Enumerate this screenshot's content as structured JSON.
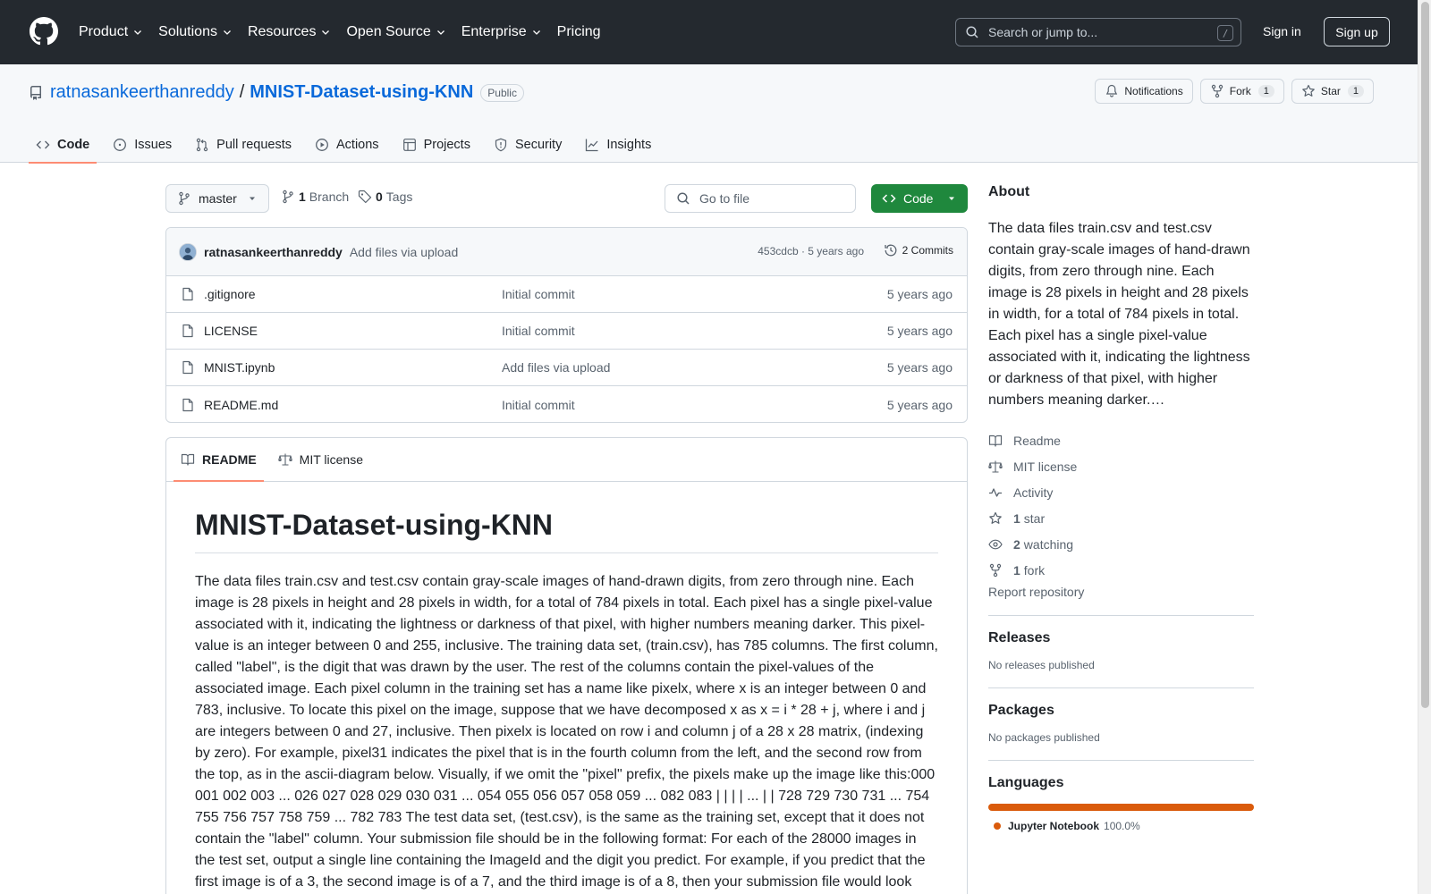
{
  "header": {
    "nav": [
      "Product",
      "Solutions",
      "Resources",
      "Open Source",
      "Enterprise",
      "Pricing"
    ],
    "search_placeholder": "Search or jump to...",
    "search_shortcut": "/",
    "sign_in": "Sign in",
    "sign_up": "Sign up"
  },
  "repo": {
    "owner": "ratnasankeerthanreddy",
    "separator": "/",
    "name": "MNIST-Dataset-using-KNN",
    "visibility": "Public",
    "notifications": "Notifications",
    "fork_label": "Fork",
    "fork_count": "1",
    "star_label": "Star",
    "star_count": "1",
    "tabs": [
      "Code",
      "Issues",
      "Pull requests",
      "Actions",
      "Projects",
      "Security",
      "Insights"
    ]
  },
  "toolbar": {
    "branch": "master",
    "branch_count": "1",
    "branch_label": "Branch",
    "tag_count": "0",
    "tag_label": "Tags",
    "goto_placeholder": "Go to file",
    "code_button": "Code"
  },
  "latest_commit": {
    "author": "ratnasankeerthanreddy",
    "message": "Add files via upload",
    "meta": "453cdcb · 5 years ago",
    "commits": "2 Commits"
  },
  "files": [
    {
      "name": ".gitignore",
      "commit": "Initial commit",
      "date": "5 years ago"
    },
    {
      "name": "LICENSE",
      "commit": "Initial commit",
      "date": "5 years ago"
    },
    {
      "name": "MNIST.ipynb",
      "commit": "Add files via upload",
      "date": "5 years ago"
    },
    {
      "name": "README.md",
      "commit": "Initial commit",
      "date": "5 years ago"
    }
  ],
  "readme": {
    "tab_readme": "README",
    "tab_license": "MIT license",
    "title": "MNIST-Dataset-using-KNN",
    "body": "The data files train.csv and test.csv contain gray-scale images of hand-drawn digits, from zero through nine. Each image is 28 pixels in height and 28 pixels in width, for a total of 784 pixels in total. Each pixel has a single pixel-value associated with it, indicating the lightness or darkness of that pixel, with higher numbers meaning darker. This pixel-value is an integer between 0 and 255, inclusive. The training data set, (train.csv), has 785 columns. The first column, called \"label\", is the digit that was drawn by the user. The rest of the columns contain the pixel-values of the associated image. Each pixel column in the training set has a name like pixelx, where x is an integer between 0 and 783, inclusive. To locate this pixel on the image, suppose that we have decomposed x as x = i * 28 + j, where i and j are integers between 0 and 27, inclusive. Then pixelx is located on row i and column j of a 28 x 28 matrix, (indexing by zero). For example, pixel31 indicates the pixel that is in the fourth column from the left, and the second row from the top, as in the ascii-diagram below. Visually, if we omit the \"pixel\" prefix, the pixels make up the image like this:000 001 002 003 ... 026 027 028 029 030 031 ... 054 055 056 057 058 059 ... 082 083 | | | | ... | | 728 729 730 731 ... 754 755 756 757 758 759 ... 782 783 The test data set, (test.csv), is the same as the training set, except that it does not contain the \"label\" column. Your submission file should be in the following format: For each of the 28000 images in the test set, output a single line containing the ImageId and the digit you predict. For example, if you predict that the first image is of a 3, the second image is of a 7, and the third image is of a 8, then your submission file would look"
  },
  "sidebar": {
    "about_title": "About",
    "description": "The data files train.csv and test.csv contain gray-scale images of hand-drawn digits, from zero through nine. Each image is 28 pixels in height and 28 pixels in width, for a total of 784 pixels in total. Each pixel has a single pixel-value associated with it, indicating the lightness or darkness of that pixel, with higher numbers meaning darker.…",
    "readme": "Readme",
    "license": "MIT license",
    "activity": "Activity",
    "stars_count": "1",
    "stars_label": "star",
    "watching_count": "2",
    "watching_label": "watching",
    "forks_count": "1",
    "forks_label": "fork",
    "report": "Report repository",
    "releases_title": "Releases",
    "releases_text": "No releases published",
    "packages_title": "Packages",
    "packages_text": "No packages published",
    "languages_title": "Languages",
    "language_name": "Jupyter Notebook",
    "language_pct": "100.0%",
    "language_color": "#da5b0b"
  }
}
